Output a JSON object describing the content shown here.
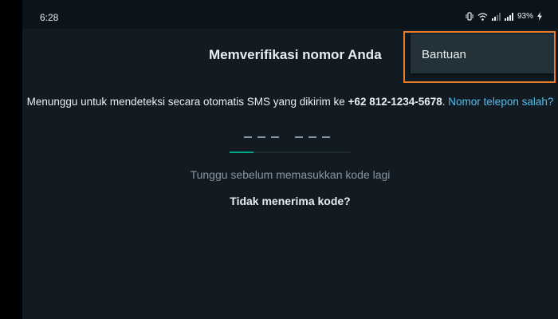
{
  "status_bar": {
    "time": "6:28",
    "battery": "93%",
    "icons": [
      "vibrate-icon",
      "wifi-icon",
      "signal-icon",
      "signal-icon",
      "battery-charging-icon"
    ]
  },
  "header": {
    "title": "Memverifikasi nomor Anda"
  },
  "overflow_menu": {
    "items": [
      {
        "label": "Bantuan"
      }
    ]
  },
  "main": {
    "message_prefix": "Menunggu untuk mendeteksi secara otomatis SMS yang dikirim ke ",
    "phone_number": "+62 812-1234-5678",
    "message_suffix": ". ",
    "wrong_number_link": "Nomor telepon salah?",
    "wait_text": "Tunggu sebelum memasukkan kode lagi",
    "no_code_text": "Tidak menerima kode?"
  },
  "colors": {
    "background": "#121b22",
    "accent": "#00a884",
    "link": "#53bdeb",
    "highlight": "#e87d2c"
  }
}
